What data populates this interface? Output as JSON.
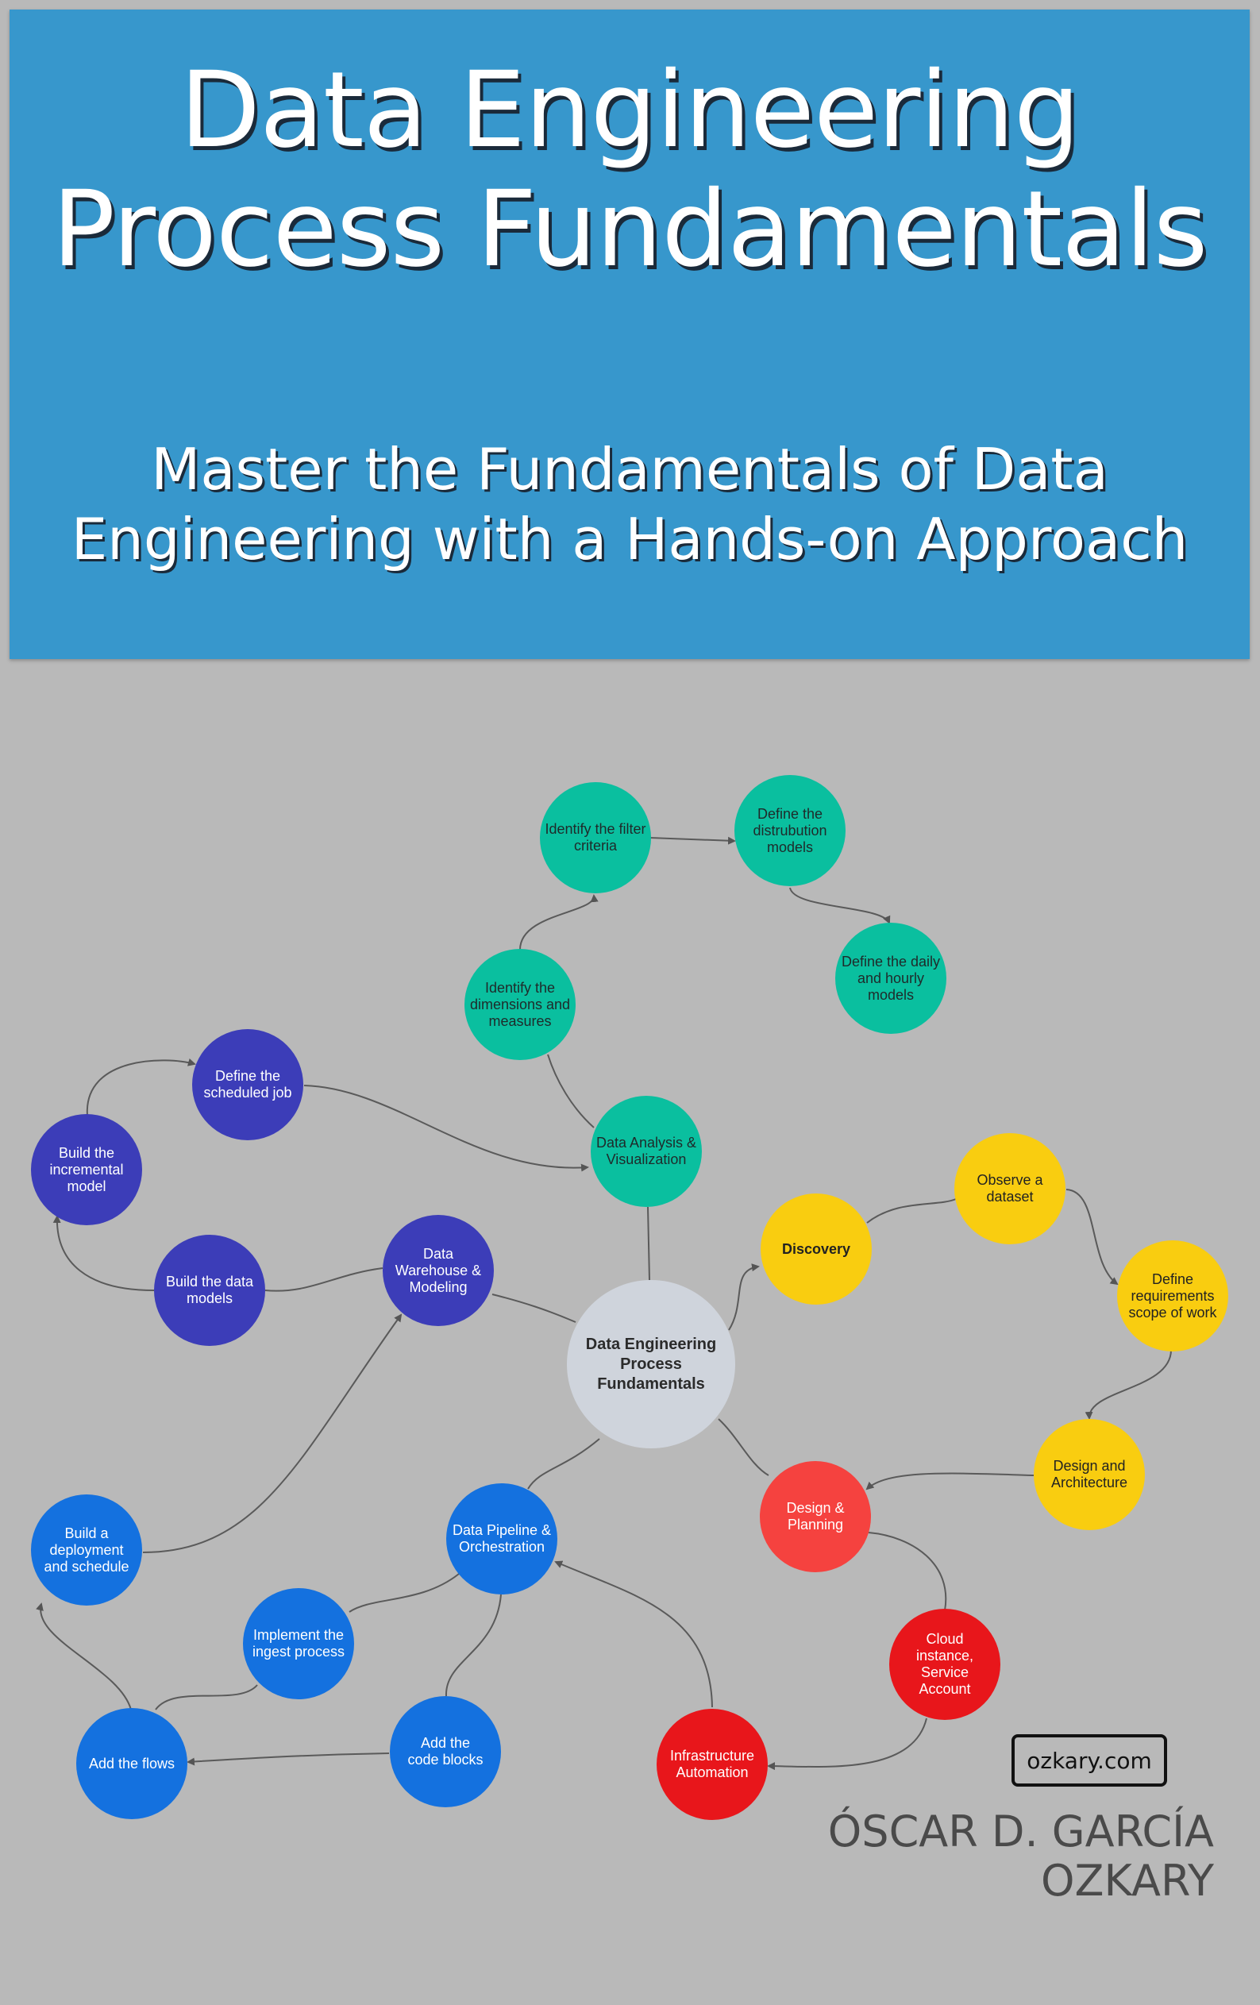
{
  "title": {
    "line1": "Data Engineering",
    "line2": "Process Fundamentals"
  },
  "subtitle": {
    "line1": "Master the Fundamentals of Data",
    "line2": "Engineering with a Hands-on Approach"
  },
  "colors": {
    "banner": "#3797cc",
    "background": "#b9b9b9",
    "teal": "#0abf9f",
    "indigo": "#3c3db8",
    "blue": "#1471df",
    "yellow": "#f9cd10",
    "red": "#e8161b",
    "salmon": "#f5423f",
    "center": "#cfd4dc"
  },
  "nodes": {
    "center": "Data Engineering Process Fundamentals",
    "data_analysis": "Data Analysis & Visualization",
    "identify_dimensions": "Identify the dimensions and measures",
    "identify_filter": "Identify the filter criteria",
    "define_distribution": "Define the distrubution models",
    "define_daily": "Define the daily and hourly models",
    "data_warehouse": "Data Warehouse & Modeling",
    "build_data_models": "Build the data models",
    "build_incremental": "Build the incremental model",
    "define_scheduled": "Define the scheduled job",
    "discovery": "Discovery",
    "observe_dataset": "Observe a dataset",
    "define_requirements": "Define requirements scope of work",
    "design_architecture": "Design and Architecture",
    "design_planning": "Design & Planning",
    "cloud_instance": "Cloud instance, Service Account",
    "infrastructure": "Infrastructure Automation",
    "data_pipeline": "Data Pipeline & Orchestration",
    "implement_ingest": "Implement the ingest process",
    "add_code": "Add the code blocks",
    "add_flows": "Add the flows",
    "build_deployment": "Build a deployment and schedule"
  },
  "website": "ozkary.com",
  "author": {
    "line1": "ÓSCAR D. GARCÍA",
    "line2": "OZKARY"
  }
}
